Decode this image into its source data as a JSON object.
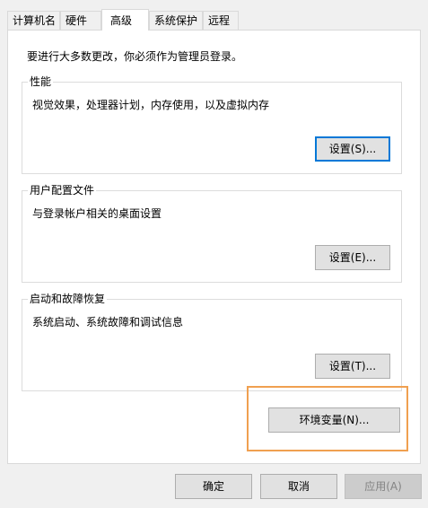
{
  "tabs": [
    {
      "label": "计算机名",
      "active": false
    },
    {
      "label": "硬件",
      "active": false
    },
    {
      "label": "高级",
      "active": true
    },
    {
      "label": "系统保护",
      "active": false
    },
    {
      "label": "远程",
      "active": false
    }
  ],
  "admin_note": "要进行大多数更改，你必须作为管理员登录。",
  "groups": {
    "performance": {
      "title": "性能",
      "description": "视觉效果，处理器计划，内存使用，以及虚拟内存",
      "button": "设置(S)..."
    },
    "user_profiles": {
      "title": "用户配置文件",
      "description": "与登录帐户相关的桌面设置",
      "button": "设置(E)..."
    },
    "startup_recovery": {
      "title": "启动和故障恢复",
      "description": "系统启动、系统故障和调试信息",
      "button": "设置(T)..."
    }
  },
  "env_vars_button": "环境变量(N)...",
  "footer": {
    "ok": "确定",
    "cancel": "取消",
    "apply": "应用(A)"
  },
  "colors": {
    "focus_border": "#0078d7",
    "highlight_box": "#f0a050"
  }
}
